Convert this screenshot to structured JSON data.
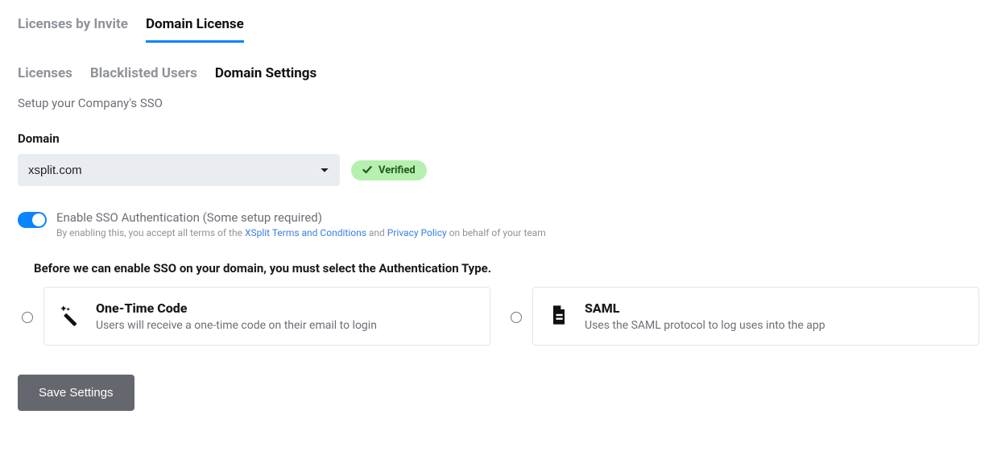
{
  "tabsPrimary": {
    "licensesByInvite": "Licenses by Invite",
    "domainLicense": "Domain License"
  },
  "tabsSecondary": {
    "licenses": "Licenses",
    "blacklisted": "Blacklisted Users",
    "domainSettings": "Domain Settings"
  },
  "subtitle": "Setup your Company's SSO",
  "domain": {
    "label": "Domain",
    "selected": "xsplit.com"
  },
  "verified": {
    "label": "Verified"
  },
  "sso": {
    "title": "Enable SSO Authentication (Some setup required)",
    "legalPrefix": "By enabling this, you accept all terms of the ",
    "termsLink": "XSplit Terms and Conditions",
    "and": " and ",
    "privacyLink": "Privacy Policy",
    "legalSuffix": " on behalf of your team"
  },
  "authHeading": "Before we can enable SSO on your domain, you must select the Authentication Type.",
  "otc": {
    "title": "One-Time Code",
    "desc": "Users will receive a one-time code on their email to login"
  },
  "saml": {
    "title": "SAML",
    "desc": "Uses the SAML protocol to log uses into the app"
  },
  "saveButton": "Save Settings"
}
